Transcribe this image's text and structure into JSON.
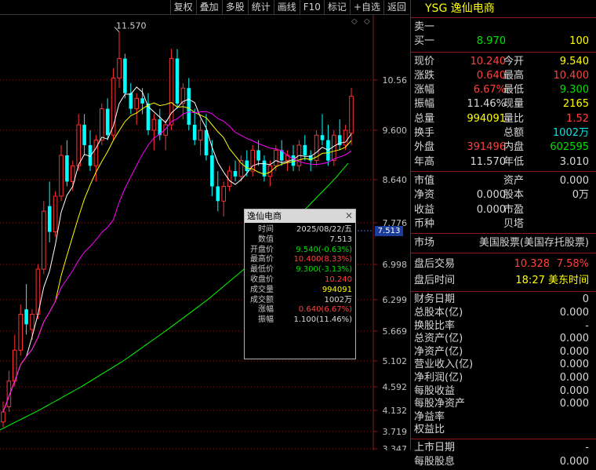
{
  "toolbar": {
    "buttons": [
      "复权",
      "叠加",
      "多股",
      "统计",
      "画线",
      "F10",
      "标记",
      "+自选",
      "返回"
    ]
  },
  "chart_data": {
    "type": "candlestick",
    "price_axis": {
      "ticks": [
        "10.56",
        "9.600",
        "8.640",
        "7.776",
        "6.998",
        "6.299",
        "5.669",
        "5.102",
        "4.592",
        "4.132",
        "3.719",
        "3.347"
      ],
      "scale": "log",
      "range": [
        3.3,
        11.6
      ]
    },
    "high_marker_label": "11.570",
    "current_price_tag": "7.513",
    "colors": {
      "up": "#ff3030",
      "down": "#00ffff",
      "ma5": "#ffffff",
      "ma10": "#ffff00",
      "ma20": "#ff00ff",
      "ma60": "#00ff00"
    },
    "candles": [
      [
        3.9,
        4.3,
        3.8,
        4.1
      ],
      [
        4.2,
        4.9,
        4.1,
        4.7
      ],
      [
        4.7,
        5.6,
        4.6,
        5.3
      ],
      [
        5.3,
        6.2,
        5.2,
        6.0
      ],
      [
        6.1,
        6.6,
        5.6,
        5.8
      ],
      [
        5.7,
        6.1,
        5.5,
        6.0
      ],
      [
        6.0,
        7.0,
        5.9,
        6.9
      ],
      [
        6.9,
        8.2,
        6.8,
        8.0
      ],
      [
        8.1,
        8.6,
        7.4,
        7.6
      ],
      [
        7.6,
        8.4,
        7.5,
        8.3
      ],
      [
        8.3,
        9.3,
        8.2,
        9.1
      ],
      [
        9.1,
        9.4,
        8.5,
        8.6
      ],
      [
        8.6,
        9.0,
        8.4,
        8.9
      ],
      [
        8.9,
        9.9,
        8.8,
        9.7
      ],
      [
        9.7,
        9.9,
        9.1,
        9.3
      ],
      [
        9.3,
        9.6,
        8.8,
        8.9
      ],
      [
        8.9,
        9.5,
        8.6,
        9.4
      ],
      [
        9.4,
        10.1,
        9.3,
        10.0
      ],
      [
        10.0,
        10.2,
        9.4,
        9.5
      ],
      [
        9.5,
        10.8,
        9.4,
        10.6
      ],
      [
        10.6,
        11.57,
        10.4,
        11.0
      ],
      [
        11.0,
        11.1,
        10.2,
        10.3
      ],
      [
        10.3,
        10.5,
        9.9,
        10.0
      ],
      [
        10.0,
        10.3,
        9.7,
        10.2
      ],
      [
        10.2,
        10.4,
        9.9,
        10.1
      ],
      [
        10.1,
        10.3,
        9.5,
        9.6
      ],
      [
        9.6,
        9.9,
        9.2,
        9.8
      ],
      [
        9.8,
        10.0,
        9.4,
        9.5
      ],
      [
        9.5,
        9.8,
        9.2,
        9.7
      ],
      [
        9.7,
        11.2,
        9.6,
        11.0
      ],
      [
        11.0,
        11.2,
        10.0,
        10.1
      ],
      [
        10.1,
        10.5,
        9.8,
        10.4
      ],
      [
        10.4,
        10.6,
        9.6,
        9.7
      ],
      [
        9.7,
        10.0,
        9.3,
        9.4
      ],
      [
        9.4,
        9.8,
        9.1,
        9.6
      ],
      [
        9.6,
        9.9,
        9.0,
        9.1
      ],
      [
        9.1,
        9.4,
        8.3,
        8.5
      ],
      [
        8.5,
        8.8,
        8.0,
        8.2
      ],
      [
        8.2,
        8.6,
        7.9,
        8.5
      ],
      [
        8.5,
        8.9,
        8.4,
        8.8
      ],
      [
        8.8,
        9.0,
        8.6,
        8.7
      ],
      [
        8.7,
        9.1,
        8.6,
        9.0
      ],
      [
        9.0,
        9.2,
        8.7,
        8.8
      ],
      [
        8.8,
        9.3,
        8.7,
        9.2
      ],
      [
        9.2,
        9.4,
        8.9,
        9.0
      ],
      [
        9.0,
        9.1,
        8.6,
        8.7
      ],
      [
        8.7,
        9.0,
        8.5,
        8.9
      ],
      [
        8.9,
        9.3,
        8.8,
        9.2
      ],
      [
        9.2,
        9.4,
        8.9,
        9.0
      ],
      [
        9.0,
        9.2,
        8.8,
        9.1
      ],
      [
        9.1,
        9.3,
        8.8,
        8.9
      ],
      [
        8.9,
        9.4,
        8.8,
        9.3
      ],
      [
        9.3,
        9.5,
        9.0,
        9.1
      ],
      [
        9.1,
        9.2,
        8.8,
        9.0
      ],
      [
        9.0,
        9.6,
        8.9,
        9.5
      ],
      [
        9.5,
        9.9,
        9.3,
        9.4
      ],
      [
        9.4,
        9.7,
        8.9,
        9.0
      ],
      [
        9.0,
        9.6,
        8.9,
        9.5
      ],
      [
        9.5,
        9.8,
        9.2,
        9.3
      ],
      [
        9.3,
        9.7,
        9.2,
        9.6
      ],
      [
        9.54,
        10.4,
        9.3,
        10.24
      ]
    ]
  },
  "tooltip": {
    "title": "逸仙电商",
    "rows": [
      {
        "label": "时间",
        "value": "2025/08/22/五",
        "color": "#d8d8d8"
      },
      {
        "label": "数值",
        "value": "7.513",
        "color": "#d8d8d8"
      },
      {
        "label": "开盘价",
        "value": "9.540(-0.63%)",
        "color": "#00e000"
      },
      {
        "label": "最高价",
        "value": "10.400(8.33%)",
        "color": "#ff4040"
      },
      {
        "label": "最低价",
        "value": "9.300(-3.13%)",
        "color": "#00e000"
      },
      {
        "label": "收盘价",
        "value": "10.240",
        "color": "#ff4040"
      },
      {
        "label": "成交量",
        "value": "994091",
        "color": "#ffff00"
      },
      {
        "label": "成交额",
        "value": "1002万",
        "color": "#d8d8d8"
      },
      {
        "label": "涨幅",
        "value": "0.640(6.67%)",
        "color": "#ff4040"
      },
      {
        "label": "振幅",
        "value": "1.100(11.46%)",
        "color": "#d8d8d8"
      }
    ]
  },
  "panel": {
    "code": "YSG",
    "name": "逸仙电商",
    "sell1_label": "卖一",
    "buy1_label": "买一",
    "buy1_price": "8.970",
    "buy1_vol": "100",
    "quote": [
      {
        "l1": "现价",
        "v1": "10.240",
        "c1": "red",
        "l2": "今开",
        "v2": "9.540",
        "c2": "yel"
      },
      {
        "l1": "涨跌",
        "v1": "0.640",
        "c1": "red",
        "l2": "最高",
        "v2": "10.400",
        "c2": "red"
      },
      {
        "l1": "涨幅",
        "v1": "6.67%",
        "c1": "red",
        "l2": "最低",
        "v2": "9.300",
        "c2": "grn"
      },
      {
        "l1": "振幅",
        "v1": "11.46%",
        "c1": "wht",
        "l2": "现量",
        "v2": "2165",
        "c2": "yel"
      },
      {
        "l1": "总量",
        "v1": "994091",
        "c1": "yel",
        "l2": "量比",
        "v2": "1.52",
        "c2": "red"
      },
      {
        "l1": "换手",
        "v1": "",
        "c1": "wht",
        "l2": "总额",
        "v2": "1002万",
        "c2": "cyn"
      },
      {
        "l1": "外盘",
        "v1": "391496",
        "c1": "red",
        "l2": "内盘",
        "v2": "602595",
        "c2": "grn"
      },
      {
        "l1": "年高",
        "v1": "11.570",
        "c1": "wht",
        "l2": "年低",
        "v2": "3.010",
        "c2": "wht"
      }
    ],
    "fund": [
      {
        "l1": "市值",
        "v1": "",
        "l2": "资产",
        "v2": "0.000"
      },
      {
        "l1": "净资",
        "v1": "0.000",
        "l2": "股本",
        "v2": "0万"
      },
      {
        "l1": "收益",
        "v1": "0.000",
        "l2": "市盈",
        "v2": ""
      },
      {
        "l1": "币种",
        "v1": "",
        "l2": "贝塔",
        "v2": ""
      }
    ],
    "market_label": "市场",
    "market_value": "美国股票(美国存托股票)",
    "after_label": "盘后交易",
    "after_price": "10.328",
    "after_pct": "7.58%",
    "after_time_label": "盘后时间",
    "after_time": "18:27 美东时间",
    "fin": [
      {
        "l": "财务日期",
        "v": "0"
      },
      {
        "l": "总股本(亿)",
        "v": "0.000"
      },
      {
        "l": "换股比率",
        "v": "-"
      },
      {
        "l": "总资产(亿)",
        "v": "0.000"
      },
      {
        "l": "净资产(亿)",
        "v": "0.000"
      },
      {
        "l": "营业收入(亿)",
        "v": "0.000"
      },
      {
        "l": "净利润(亿)",
        "v": "0.000"
      },
      {
        "l": "每股收益",
        "v": "0.000"
      },
      {
        "l": "每股净资产",
        "v": "0.000"
      },
      {
        "l": "净益率",
        "v": ""
      },
      {
        "l": "权益比",
        "v": ""
      }
    ],
    "list_label": "上市日期",
    "list_value": "-",
    "last_label": "每股股息",
    "last_value": "0.000"
  }
}
